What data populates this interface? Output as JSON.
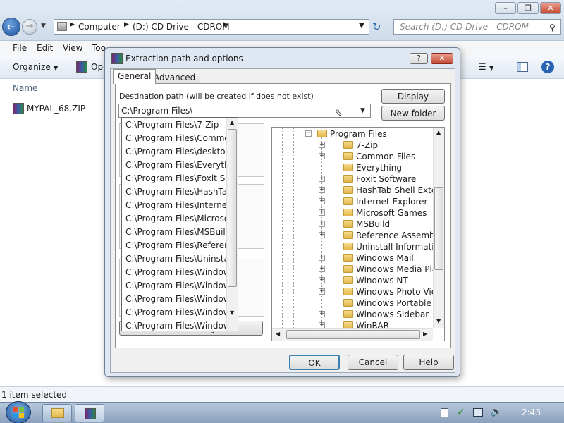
{
  "explorer": {
    "breadcrumb": [
      "Computer",
      "(D:) CD Drive - CDROM"
    ],
    "search_placeholder": "Search (D:) CD Drive - CDROM",
    "menu": [
      "File",
      "Edit",
      "View",
      "Too"
    ],
    "toolbar": {
      "organize": "Organize",
      "open": "Ope"
    },
    "column_name": "Name",
    "files": [
      {
        "name": "MYPAL_68.ZIP"
      }
    ],
    "status": "1 item selected"
  },
  "dialog": {
    "title": "Extraction path and options",
    "title_help": "?",
    "tabs": [
      "General",
      "Advanced"
    ],
    "dest_label": "Destination path (will be created if does not exist)",
    "dest_value": "C:\\Program Files\\",
    "buttons": {
      "display": "Display",
      "new_folder": "New folder",
      "save_settings": "Save settings",
      "ok": "OK",
      "cancel": "Cancel",
      "help": "Help"
    },
    "dropdown_items": [
      "C:\\Program Files\\7-Zip",
      "C:\\Program Files\\Common",
      "C:\\Program Files\\desktop.ini",
      "C:\\Program Files\\Everythin",
      "C:\\Program Files\\Foxit Soft",
      "C:\\Program Files\\HashTab",
      "C:\\Program Files\\Internet E",
      "C:\\Program Files\\Microsoft",
      "C:\\Program Files\\MSBuild",
      "C:\\Program Files\\Reference",
      "C:\\Program Files\\Uninstall",
      "C:\\Program Files\\Windows",
      "C:\\Program Files\\Windows",
      "C:\\Program Files\\Windows",
      "C:\\Program Files\\Windows",
      "C:\\Program Files\\Windows"
    ],
    "tree_root": "Program Files",
    "tree_items": [
      "7-Zip",
      "Common Files",
      "Everything",
      "Foxit Software",
      "HashTab Shell Extension",
      "Internet Explorer",
      "Microsoft Games",
      "MSBuild",
      "Reference Assemblies",
      "Uninstall Information",
      "Windows Mail",
      "Windows Media Player",
      "Windows NT",
      "Windows Photo Viewer",
      "Windows Portable Devices",
      "Windows Sidebar",
      "WinRAR"
    ]
  },
  "taskbar": {
    "clock": "2:43"
  }
}
